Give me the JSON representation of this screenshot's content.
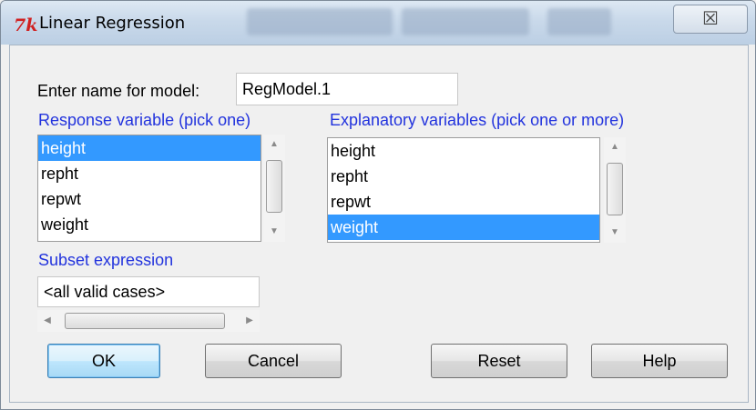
{
  "window": {
    "title": "Linear Regression",
    "close_glyph": "☒",
    "icon": "tk-feather-icon",
    "blurred_toolbar": [
      "Edit data set",
      "View data set",
      "Model"
    ]
  },
  "model_name": {
    "label": "Enter name for model:",
    "value": "RegModel.1"
  },
  "response": {
    "label": "Response variable (pick one)",
    "items": [
      "height",
      "repht",
      "repwt",
      "weight"
    ],
    "selected": "height"
  },
  "explanatory": {
    "label": "Explanatory variables (pick one or more)",
    "items": [
      "height",
      "repht",
      "repwt",
      "weight"
    ],
    "selected": "weight"
  },
  "subset": {
    "label": "Subset expression",
    "value": "<all valid cases>"
  },
  "buttons": {
    "ok": "OK",
    "cancel": "Cancel",
    "reset": "Reset",
    "help": "Help"
  },
  "colors": {
    "selection": "#3399ff",
    "label_blue": "#2233dd",
    "icon_red": "#d02020"
  }
}
